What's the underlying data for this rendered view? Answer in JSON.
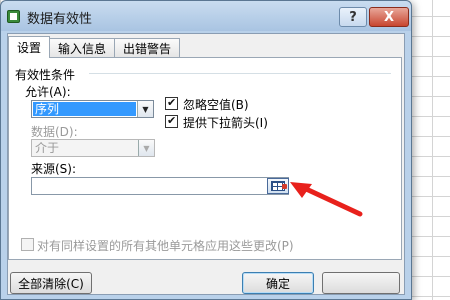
{
  "dialog": {
    "title": "数据有效性",
    "help_label": "?",
    "close_label": "X"
  },
  "tabs": [
    {
      "label": "设置",
      "active": true
    },
    {
      "label": "输入信息",
      "active": false
    },
    {
      "label": "出错警告",
      "active": false
    }
  ],
  "settings": {
    "group_title": "有效性条件",
    "allow_label": "允许(A):",
    "allow_value": "序列",
    "ignore_blank_label": "忽略空值(B)",
    "ignore_blank_checked": true,
    "dropdown_label": "提供下拉箭头(I)",
    "dropdown_checked": true,
    "data_label": "数据(D):",
    "data_value": "介于",
    "source_label": "来源(S):",
    "source_value": "",
    "apply_all_label": "对有同样设置的所有其他单元格应用这些更改(P)",
    "apply_all_checked": false
  },
  "footer": {
    "clear_all_label": "全部清除(C)",
    "ok_label": "确定"
  },
  "colors": {
    "dialog_frame": "#b9d1ea",
    "selection": "#3399ff",
    "annotation_arrow": "#e8211c"
  }
}
